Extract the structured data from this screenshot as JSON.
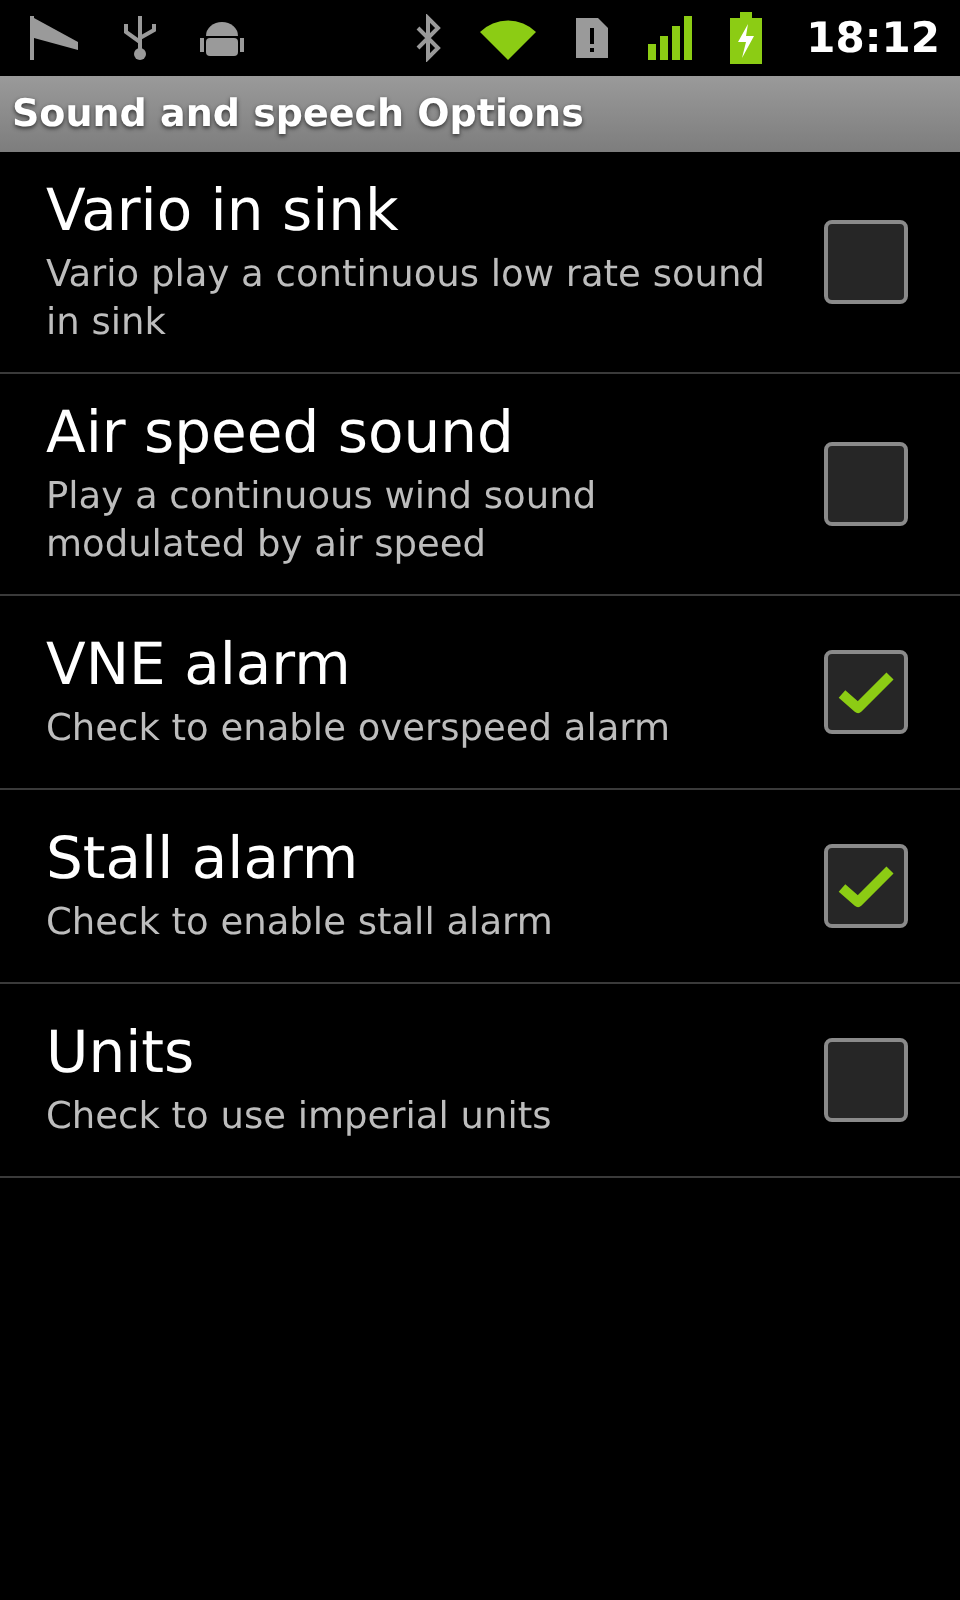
{
  "status_bar": {
    "time": "18:12"
  },
  "title_bar": {
    "title": "Sound and speech Options"
  },
  "preferences": [
    {
      "title": "Vario in sink",
      "summary": "Vario play a continuous low rate sound in sink",
      "checked": false
    },
    {
      "title": "Air speed sound",
      "summary": "Play a continuous wind sound modulated by air speed",
      "checked": false
    },
    {
      "title": "VNE alarm",
      "summary": "Check to enable overspeed alarm",
      "checked": true
    },
    {
      "title": "Stall alarm",
      "summary": "Check to enable stall alarm",
      "checked": true
    },
    {
      "title": "Units",
      "summary": "Check to use imperial units",
      "checked": false
    }
  ]
}
